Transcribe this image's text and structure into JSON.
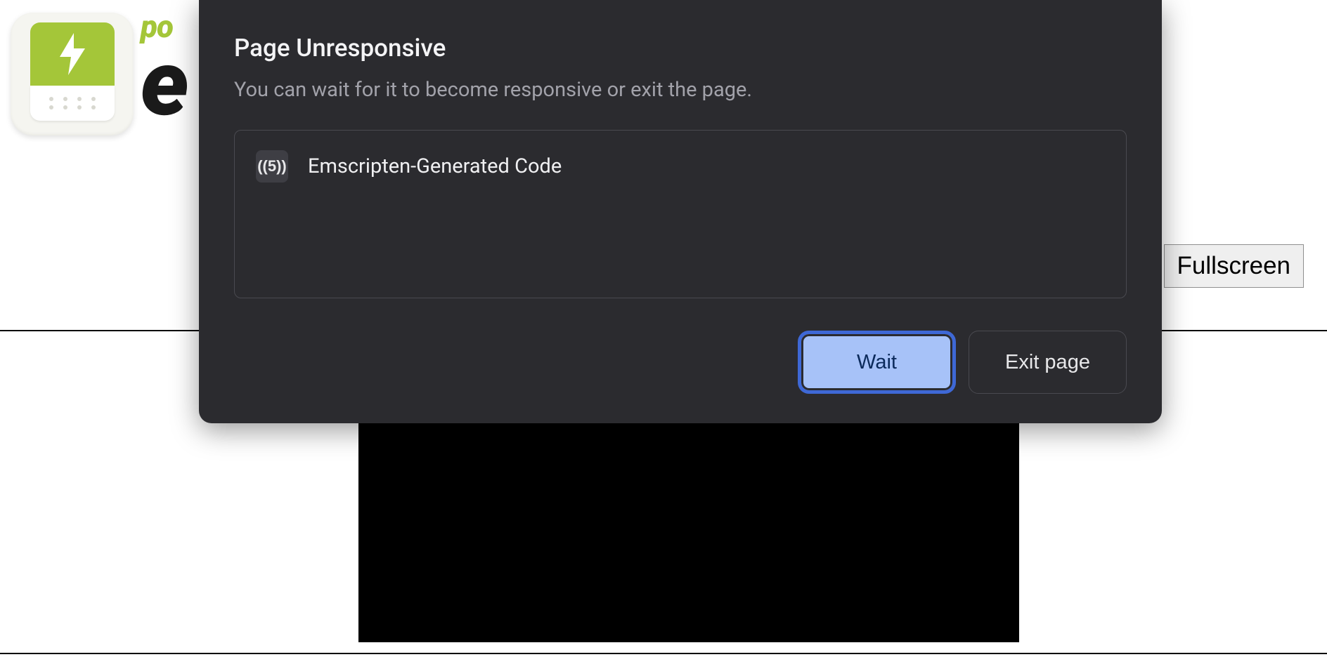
{
  "page": {
    "brand_small": "po",
    "brand_big": "e",
    "fullscreen_label": "Fullscreen"
  },
  "dialog": {
    "title": "Page Unresponsive",
    "subtitle": "You can wait for it to become responsive or exit the page.",
    "items": [
      {
        "icon_text": "((5))",
        "label": "Emscripten-Generated Code"
      }
    ],
    "buttons": {
      "primary": "Wait",
      "secondary": "Exit page"
    }
  }
}
